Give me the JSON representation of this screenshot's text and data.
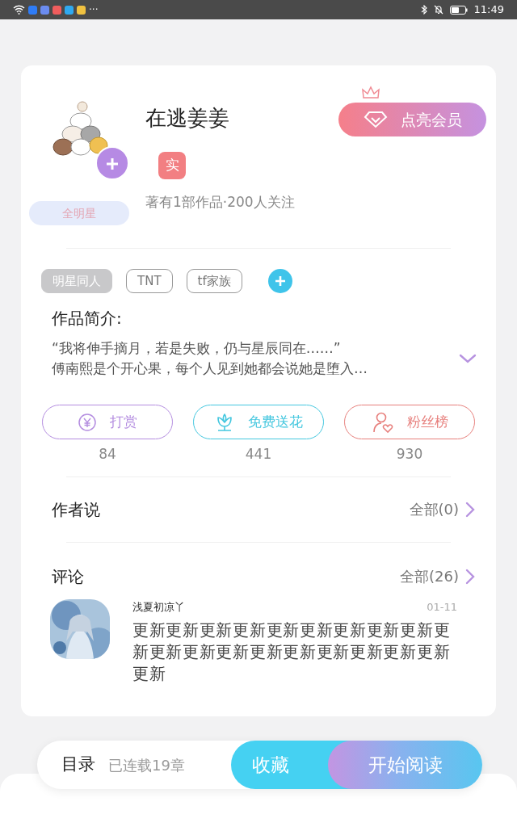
{
  "status_bar": {
    "more": "···",
    "time": "11:49"
  },
  "profile": {
    "name": "在逃姜姜",
    "badge": "实",
    "medal": "全明星",
    "stats": "著有1部作品·200人关注",
    "vip_button": "点亮会员"
  },
  "tags": [
    {
      "label": "明星同人",
      "kind": "category"
    },
    {
      "label": "TNT",
      "kind": "tag"
    },
    {
      "label": "tf家族",
      "kind": "tag"
    }
  ],
  "intro": {
    "title": "作品简介:",
    "lines": [
      "“我将伸手摘月，若是失败，仍与星辰同在……”",
      "傅南熙是个开心果，每个人见到她都会说她是堕入…"
    ],
    "expanded": false
  },
  "actions": [
    {
      "kind": "reward",
      "label": "打赏",
      "count": "84",
      "color": "#b48de0"
    },
    {
      "kind": "flower",
      "label": "免费送花",
      "count": "441",
      "color": "#44c7df"
    },
    {
      "kind": "fans",
      "label": "粉丝榜",
      "count": "930",
      "color": "#e77f7c"
    }
  ],
  "author_says": {
    "title": "作者说",
    "link": "全部(0)"
  },
  "comments": {
    "title": "评论",
    "link": "全部(26)",
    "items": [
      {
        "user": "浅夏初凉丫",
        "date": "01-11",
        "text": "更新更新更新更新更新更新更新更新更新更新更新更新更新更新更新更新更新更新更新更新"
      }
    ]
  },
  "bottom_bar": {
    "toc": "目录",
    "progress": "已连载19章",
    "collect": "收藏",
    "read": "开始阅读"
  }
}
